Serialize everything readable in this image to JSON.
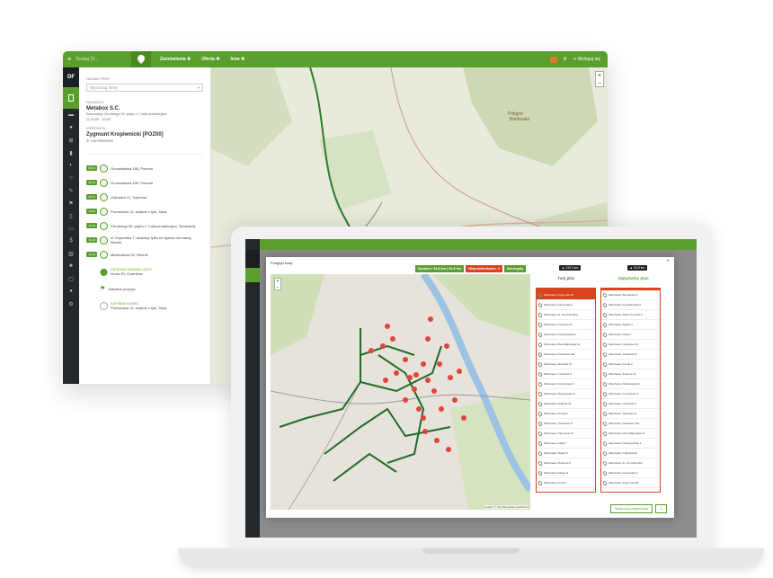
{
  "app": {
    "search_placeholder": "Szukaj (S...",
    "nav": [
      {
        "label": "Zamówienia ✚"
      },
      {
        "label": "Oferta ✚"
      },
      {
        "label": "Inne ✚"
      }
    ],
    "logout": "Wyloguj się",
    "brand": "DF",
    "brand_label": "Zamówienia"
  },
  "order": {
    "firm_label": "NAZWA FIRMY",
    "firm_placeholder": "Wyszukaj firmę",
    "sender_label": "NADAWCA",
    "sender_name": "Metabox S.C.",
    "sender_address": "Szamotuły, Chrobrego 50, piętro 1 / hala produkcyjna",
    "sender_time": "10:00 - 12:00",
    "driver_label": "KIEROWCA",
    "driver_name": "Zygmunt Kropiwnicki [POZ00]",
    "driver_phone": "+48799999999"
  },
  "route": [
    {
      "badge": "08:30",
      "text": "Grunwaldzka 180, Poznań"
    },
    {
      "badge": "09:10",
      "text": "Grunwaldzka 189, Poznań"
    },
    {
      "badge": "09:45",
      "text": "Gołuszka 12, Dąbrowa"
    },
    {
      "badge": "10:20",
      "text": "Poznańska 13, wejście z tyłu, Sady"
    },
    {
      "badge": "11:00",
      "text": "Chrobrego 50, piętro 1 / hala produkcyjna, Szamotuły"
    },
    {
      "badge": "11:40",
      "text": "ul. Kopernika 7, dostawy tylko ze wjazdu od bramy, Wronki"
    },
    {
      "badge": "12:20",
      "text": "Mickiewicza 32, Wronki"
    }
  ],
  "route_extra": {
    "status_label": "OSTATNIO WIDZIANY AUTO",
    "status_place": "Kirula 30, Czarnków",
    "current_label": "Aktualna pozycja",
    "end_label": "KATYŃSKI KONIEC",
    "end_place": "Poznańska 13, wejście z tyłu, Sady"
  },
  "modal": {
    "title": "Podgląd trasy",
    "stats": [
      {
        "label": "Dystans: 33.8 km | 54.8 km",
        "color": "#5a9e2e"
      },
      {
        "label": "Niepotwierdzone: 1",
        "color": "#d9431e"
      },
      {
        "label": "Szczegóły",
        "color": "#5a9e2e"
      }
    ],
    "col_left_head": "▲ 133.3 km",
    "col_right_head": "▲ 33.8 km",
    "col_left_title": "Twój plan",
    "col_right_title": "Optymalny plan",
    "footer_apply": "Wyślij nowy program trasy",
    "map_attrib": "Leaflet | © OpenStreetMap contributors",
    "cards_left": [
      "Warszawa, Zygmunta 55",
      "Warszawa, Kasprzaka 4",
      "Warszawa, Al. Jerozolimskie",
      "Warszawa, Grójecka 99",
      "Warszawa, Nowogrodzka 1",
      "Warszawa, Marszałkowska 12",
      "Warszawa, Puławska 140",
      "Warszawa, Wołoska 12",
      "Warszawa, Chmielna 5",
      "Warszawa, Koszykowa 3",
      "Warszawa, Mokotowska 6",
      "Warszawa, Żelazna 14",
      "Warszawa, Prosta 2",
      "Warszawa, Towarowa 8",
      "Warszawa, Okopowa 10",
      "Warszawa, Dzika 7",
      "Warszawa, Stawki 1",
      "Warszawa, Miodowa 9",
      "Warszawa, Długa 11",
      "Warszawa, Freta 4"
    ],
    "cards_right": [
      "Warszawa, Bednarska 3",
      "Warszawa, Konwiktorska 6",
      "Warszawa, Zakroczymska 9",
      "Warszawa, Stawki 1",
      "Warszawa, Dzika 7",
      "Warszawa, Okopowa 10",
      "Warszawa, Towarowa 8",
      "Warszawa, Prosta 2",
      "Warszawa, Żelazna 14",
      "Warszawa, Mokotowska 6",
      "Warszawa, Koszykowa 3",
      "Warszawa, Chmielna 5",
      "Warszawa, Wołoska 12",
      "Warszawa, Puławska 140",
      "Warszawa, Marszałkowska 12",
      "Warszawa, Nowogrodzka 1",
      "Warszawa, Grójecka 99",
      "Warszawa, Al. Jerozolimskie",
      "Warszawa, Kasprzaka 4",
      "Warszawa, Zygmunta 55"
    ]
  },
  "colors": {
    "brand_green": "#5a9e2e",
    "alert_red": "#d9431e",
    "sidebar_dark": "#23282d"
  }
}
